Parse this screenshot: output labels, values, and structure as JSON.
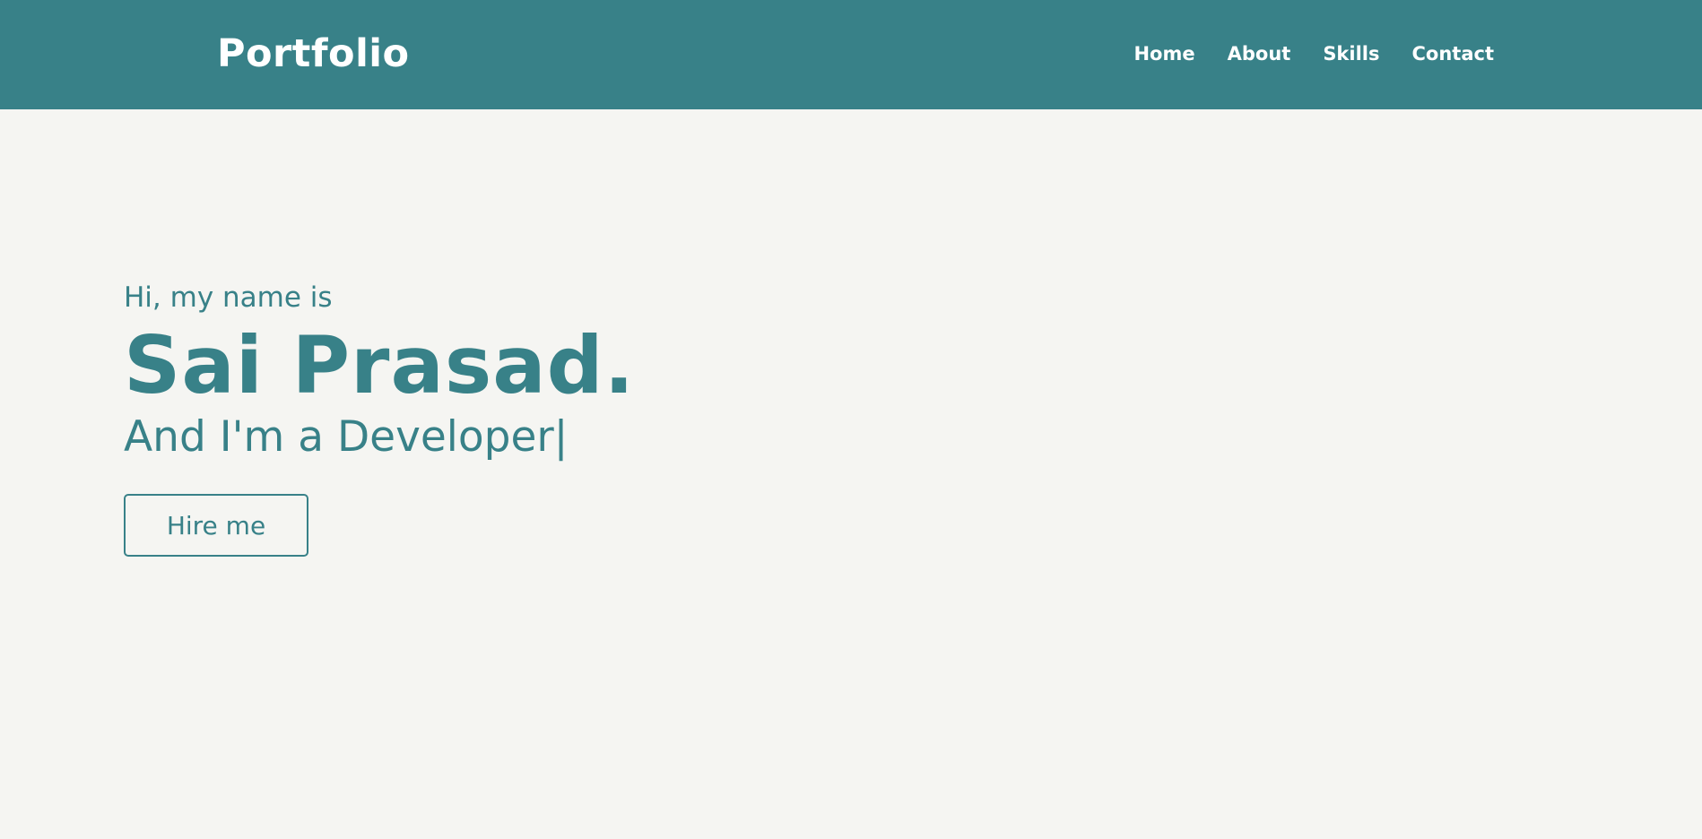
{
  "navbar": {
    "logo": "Portfolio",
    "links": [
      {
        "label": "Home"
      },
      {
        "label": "About"
      },
      {
        "label": "Skills"
      },
      {
        "label": "Contact"
      }
    ]
  },
  "hero": {
    "greeting": "Hi, my name is",
    "name": "Sai Prasad.",
    "tagline": "And I'm a Developer|",
    "button_label": "Hire me"
  },
  "colors": {
    "brand": "#388188",
    "background": "#f5f5f2",
    "nav_text": "#ffffff"
  }
}
